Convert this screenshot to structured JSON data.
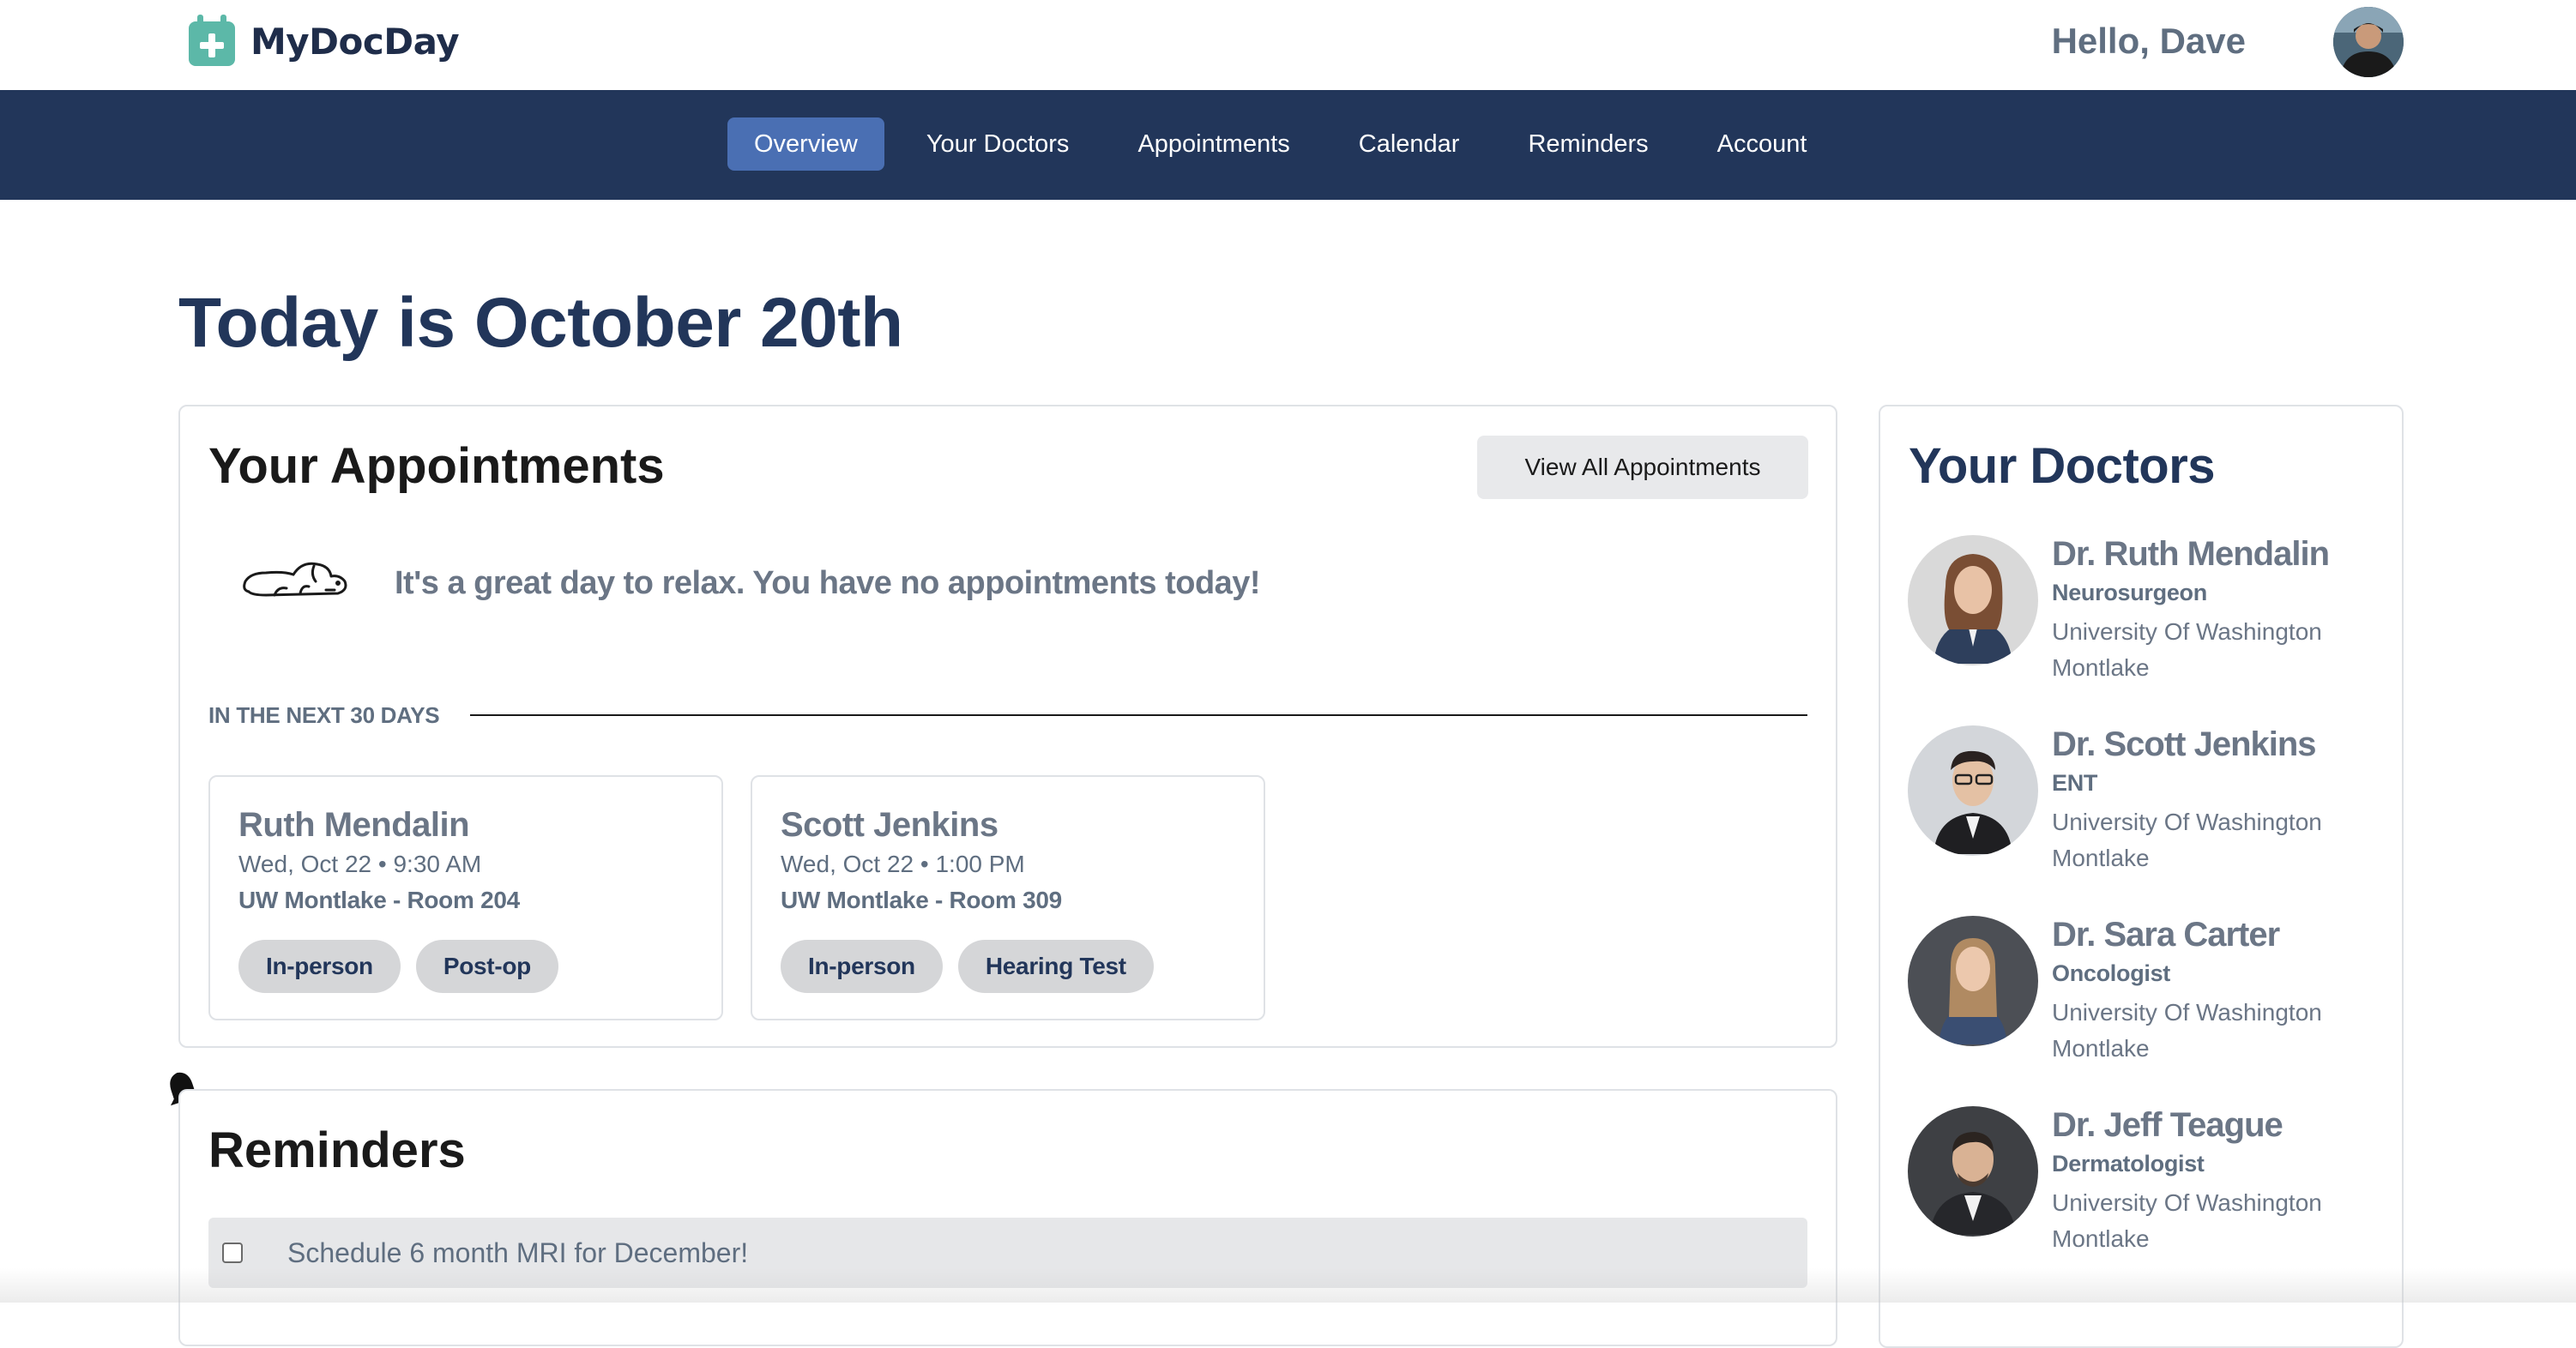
{
  "app": {
    "name": "MyDocDay",
    "greeting": "Hello, Dave"
  },
  "nav": {
    "items": [
      {
        "label": "Overview",
        "active": true
      },
      {
        "label": "Your Doctors",
        "active": false
      },
      {
        "label": "Appointments",
        "active": false
      },
      {
        "label": "Calendar",
        "active": false
      },
      {
        "label": "Reminders",
        "active": false
      },
      {
        "label": "Account",
        "active": false
      }
    ]
  },
  "page": {
    "title": "Today is October 20th"
  },
  "appointments": {
    "title": "Your Appointments",
    "view_all_label": "View All Appointments",
    "empty_message": "It's a great day to relax. You have no appointments today!",
    "upcoming_label": "IN THE NEXT 30 DAYS",
    "upcoming": [
      {
        "name": "Ruth Mendalin",
        "time": "Wed, Oct 22 • 9:30 AM",
        "location": "UW Montlake - Room 204",
        "tags": [
          "In-person",
          "Post-op"
        ]
      },
      {
        "name": "Scott Jenkins",
        "time": "Wed, Oct 22 • 1:00 PM",
        "location": "UW Montlake - Room 309",
        "tags": [
          "In-person",
          "Hearing Test"
        ]
      }
    ]
  },
  "reminders": {
    "title": "Reminders",
    "items": [
      {
        "text": "Schedule 6 month MRI for December!",
        "checked": false
      }
    ]
  },
  "doctors": {
    "title": "Your Doctors",
    "list": [
      {
        "name": "Dr. Ruth Mendalin",
        "specialty": "Neurosurgeon",
        "institution": "University Of Washington Montlake"
      },
      {
        "name": "Dr. Scott Jenkins",
        "specialty": "ENT",
        "institution": "University Of Washington Montlake"
      },
      {
        "name": "Dr. Sara Carter",
        "specialty": "Oncologist",
        "institution": "University Of Washington Montlake"
      },
      {
        "name": "Dr. Jeff Teague",
        "specialty": "Dermatologist",
        "institution": "University Of Washington Montlake"
      }
    ]
  },
  "colors": {
    "nav_bg": "#22365a",
    "nav_active": "#4a6fb3",
    "logo_teal": "#5cb8a8",
    "heading": "#22365a"
  },
  "icons": [
    "calendar-plus-icon",
    "sleeping-dog-icon",
    "bell-icon",
    "checkbox-icon"
  ]
}
